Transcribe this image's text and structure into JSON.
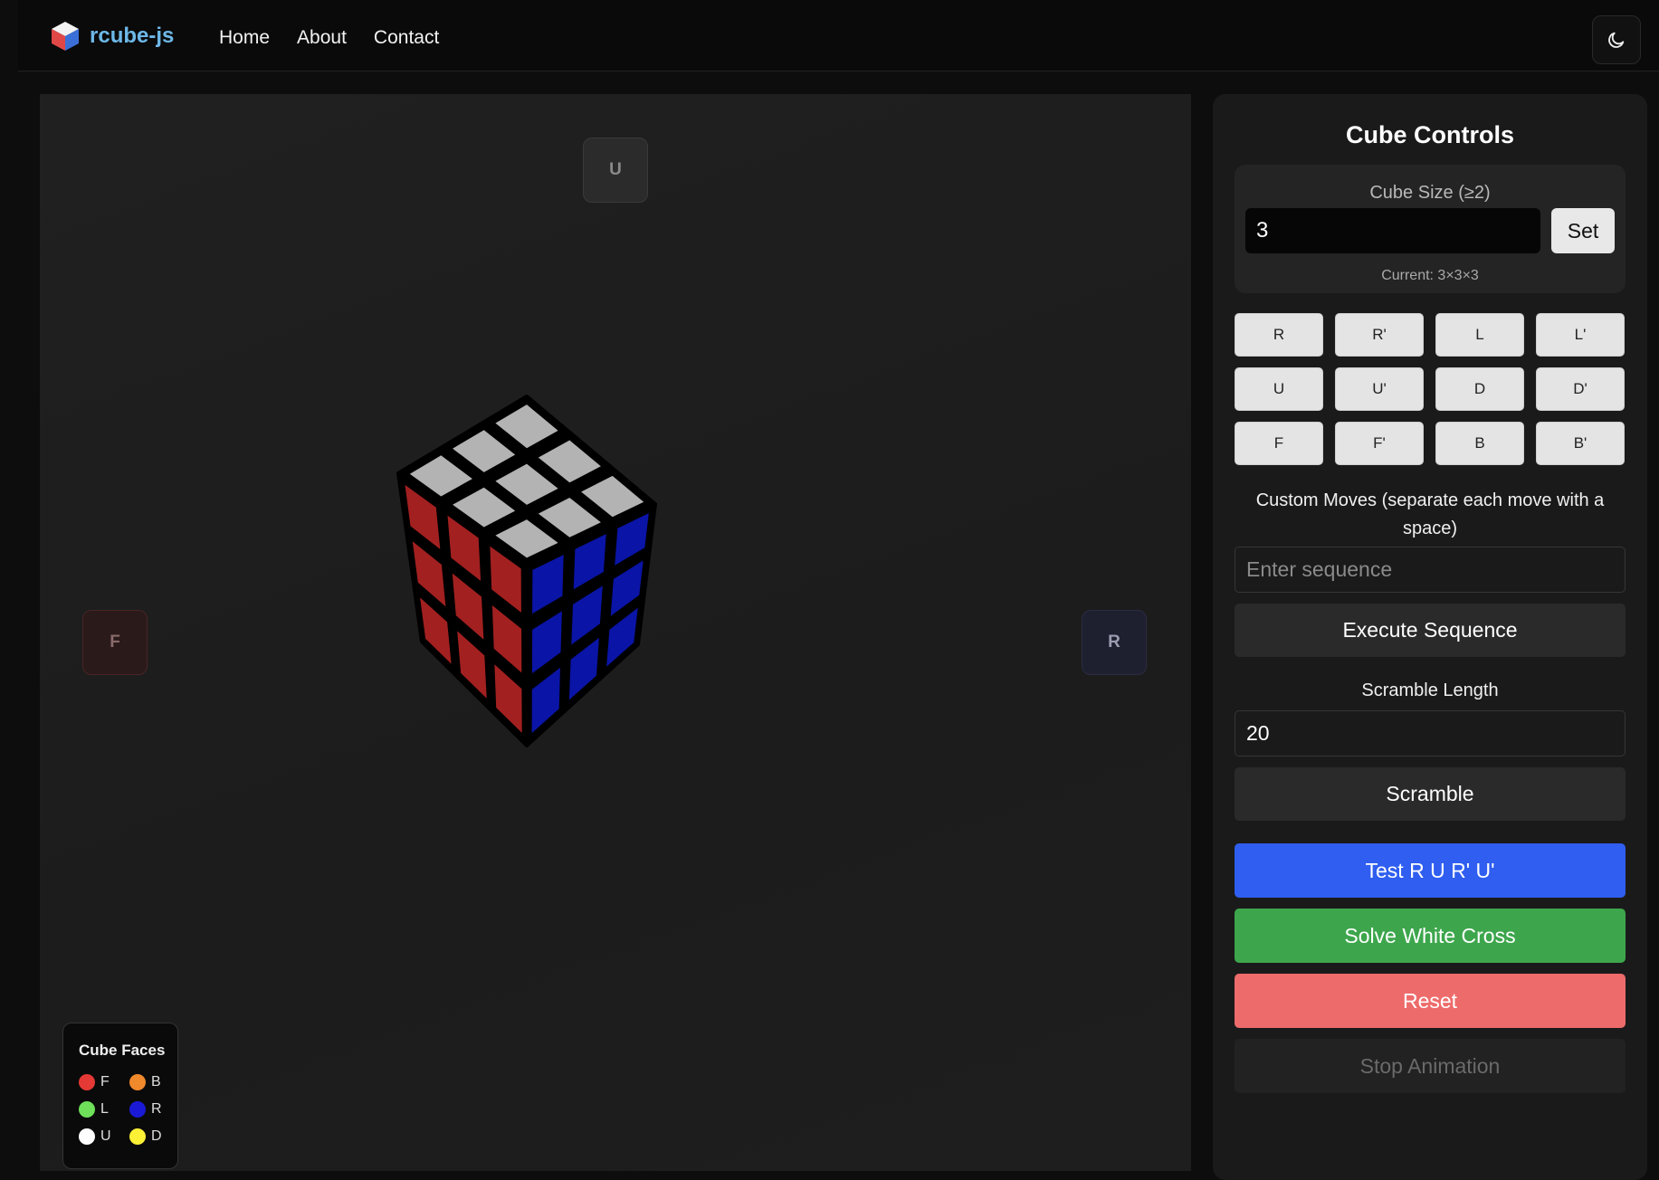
{
  "header": {
    "brand": "rcube-js",
    "nav": [
      "Home",
      "About",
      "Contact"
    ],
    "theme_icon": "moon-icon"
  },
  "viewport": {
    "face_labels": {
      "up": "U",
      "front": "F",
      "right": "R"
    },
    "cube": {
      "up_color": "#b3b3b3",
      "front_color": "#a32020",
      "right_color": "#0a14a6"
    },
    "legend": {
      "title": "Cube Faces",
      "items": [
        {
          "label": "F",
          "color": "#e53935"
        },
        {
          "label": "B",
          "color": "#f0892c"
        },
        {
          "label": "L",
          "color": "#6ee05a"
        },
        {
          "label": "R",
          "color": "#1a1ad6"
        },
        {
          "label": "U",
          "color": "#ffffff"
        },
        {
          "label": "D",
          "color": "#fdf135"
        }
      ]
    }
  },
  "controls": {
    "title": "Cube Controls",
    "size_label": "Cube Size (≥2)",
    "size_value": "3",
    "set_label": "Set",
    "current": "Current: 3×3×3",
    "moves": [
      "R",
      "R'",
      "L",
      "L'",
      "U",
      "U'",
      "D",
      "D'",
      "F",
      "F'",
      "B",
      "B'"
    ],
    "custom_label": "Custom Moves (separate each move with a space)",
    "sequence_placeholder": "Enter sequence",
    "execute_label": "Execute Sequence",
    "scramble_length_label": "Scramble Length",
    "scramble_length_value": "20",
    "scramble_label": "Scramble",
    "test_label": "Test R U R' U'",
    "cross_label": "Solve White Cross",
    "reset_label": "Reset",
    "stop_label": "Stop Animation"
  }
}
